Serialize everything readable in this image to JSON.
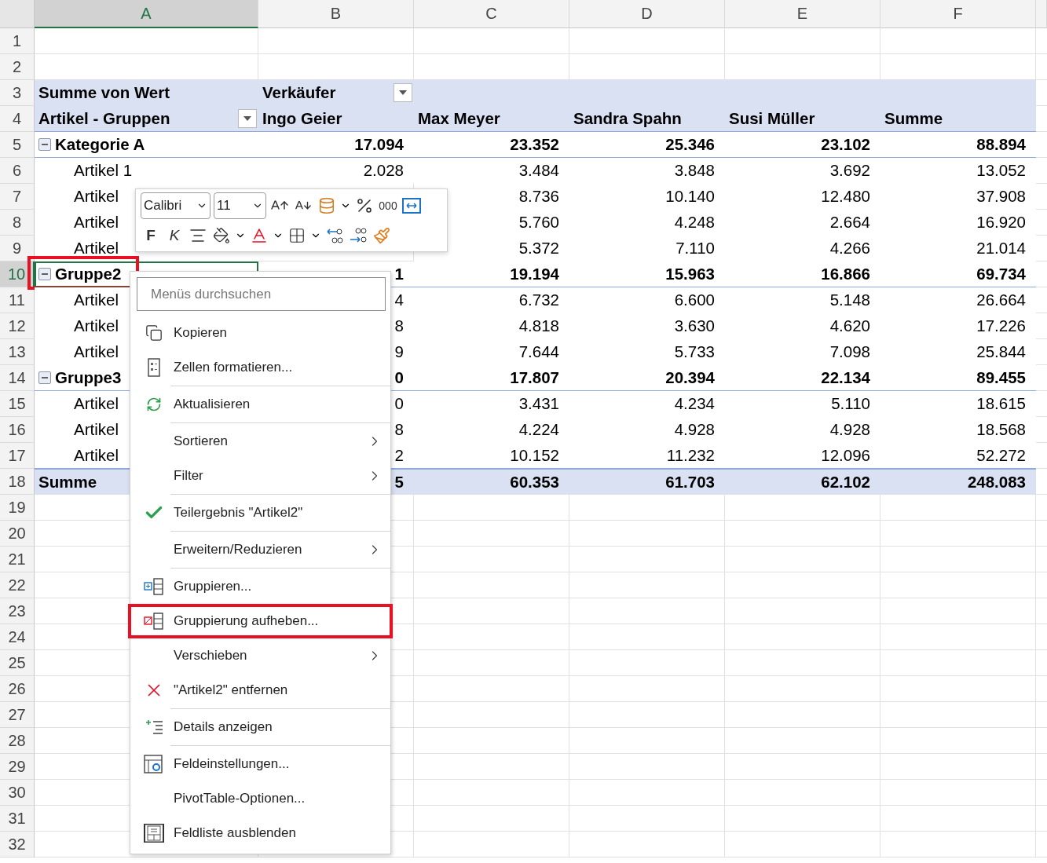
{
  "columns": [
    {
      "label": "A",
      "selected": true
    },
    {
      "label": "B",
      "selected": false
    },
    {
      "label": "C",
      "selected": false
    },
    {
      "label": "D",
      "selected": false
    },
    {
      "label": "E",
      "selected": false
    },
    {
      "label": "F",
      "selected": false
    }
  ],
  "rows": [
    {
      "number": "1",
      "kind": "blank",
      "selected": false,
      "cells": [
        null,
        null,
        null,
        null,
        null,
        null
      ]
    },
    {
      "number": "2",
      "kind": "blank",
      "selected": false,
      "cells": [
        null,
        null,
        null,
        null,
        null,
        null
      ]
    },
    {
      "number": "3",
      "kind": "header",
      "selected": false,
      "cells": [
        {
          "text": "Summe von Wert"
        },
        {
          "text": "Verkäufer",
          "dropdown": true
        },
        null,
        null,
        null,
        null
      ]
    },
    {
      "number": "4",
      "kind": "header-last",
      "selected": false,
      "cells": [
        {
          "text": "Artikel - Gruppen",
          "dropdown": true
        },
        {
          "text": "Ingo Geier"
        },
        {
          "text": "Max Meyer"
        },
        {
          "text": "Sandra Spahn"
        },
        {
          "text": "Susi Müller"
        },
        {
          "text": "Summe"
        }
      ]
    },
    {
      "number": "5",
      "kind": "group",
      "expanded": true,
      "selected": false,
      "cells": [
        {
          "text": "Kategorie A"
        },
        {
          "text": "17.094"
        },
        {
          "text": "23.352"
        },
        {
          "text": "25.346"
        },
        {
          "text": "23.102"
        },
        {
          "text": "88.894"
        }
      ]
    },
    {
      "number": "6",
      "kind": "item",
      "selected": false,
      "cells": [
        {
          "text": "Artikel 1"
        },
        {
          "text": "2.028"
        },
        {
          "text": "3.484"
        },
        {
          "text": "3.848"
        },
        {
          "text": "3.692"
        },
        {
          "text": "13.052"
        }
      ]
    },
    {
      "number": "7",
      "kind": "item",
      "selected": false,
      "cells": [
        {
          "text": "Artikel"
        },
        null,
        {
          "text": "8.736"
        },
        {
          "text": "10.140"
        },
        {
          "text": "12.480"
        },
        {
          "text": "37.908"
        }
      ]
    },
    {
      "number": "8",
      "kind": "item",
      "selected": false,
      "cells": [
        {
          "text": "Artikel"
        },
        null,
        {
          "text": "5.760"
        },
        {
          "text": "4.248"
        },
        {
          "text": "2.664"
        },
        {
          "text": "16.920"
        }
      ]
    },
    {
      "number": "9",
      "kind": "item",
      "selected": false,
      "cells": [
        {
          "text": "Artikel"
        },
        null,
        {
          "text": "5.372"
        },
        {
          "text": "7.110"
        },
        {
          "text": "4.266"
        },
        {
          "text": "21.014"
        }
      ]
    },
    {
      "number": "10",
      "kind": "group",
      "expanded": true,
      "selected": true,
      "highlighted": true,
      "cells": [
        {
          "text": "Gruppe2"
        },
        {
          "text": "1"
        },
        {
          "text": "19.194"
        },
        {
          "text": "15.963"
        },
        {
          "text": "16.866"
        },
        {
          "text": "69.734"
        }
      ]
    },
    {
      "number": "11",
      "kind": "item",
      "selected": false,
      "cells": [
        {
          "text": "Artikel"
        },
        {
          "text": "4"
        },
        {
          "text": "6.732"
        },
        {
          "text": "6.600"
        },
        {
          "text": "5.148"
        },
        {
          "text": "26.664"
        }
      ]
    },
    {
      "number": "12",
      "kind": "item",
      "selected": false,
      "cells": [
        {
          "text": "Artikel"
        },
        {
          "text": "8"
        },
        {
          "text": "4.818"
        },
        {
          "text": "3.630"
        },
        {
          "text": "4.620"
        },
        {
          "text": "17.226"
        }
      ]
    },
    {
      "number": "13",
      "kind": "item",
      "selected": false,
      "cells": [
        {
          "text": "Artikel"
        },
        {
          "text": "9"
        },
        {
          "text": "7.644"
        },
        {
          "text": "5.733"
        },
        {
          "text": "7.098"
        },
        {
          "text": "25.844"
        }
      ]
    },
    {
      "number": "14",
      "kind": "group",
      "expanded": true,
      "selected": false,
      "cells": [
        {
          "text": "Gruppe3"
        },
        {
          "text": "0"
        },
        {
          "text": "17.807"
        },
        {
          "text": "20.394"
        },
        {
          "text": "22.134"
        },
        {
          "text": "89.455"
        }
      ]
    },
    {
      "number": "15",
      "kind": "item",
      "selected": false,
      "cells": [
        {
          "text": "Artikel"
        },
        {
          "text": "0"
        },
        {
          "text": "3.431"
        },
        {
          "text": "4.234"
        },
        {
          "text": "5.110"
        },
        {
          "text": "18.615"
        }
      ]
    },
    {
      "number": "16",
      "kind": "item",
      "selected": false,
      "cells": [
        {
          "text": "Artikel"
        },
        {
          "text": "8"
        },
        {
          "text": "4.224"
        },
        {
          "text": "4.928"
        },
        {
          "text": "4.928"
        },
        {
          "text": "18.568"
        }
      ]
    },
    {
      "number": "17",
      "kind": "item-last",
      "selected": false,
      "cells": [
        {
          "text": "Artikel"
        },
        {
          "text": "2"
        },
        {
          "text": "10.152"
        },
        {
          "text": "11.232"
        },
        {
          "text": "12.096"
        },
        {
          "text": "52.272"
        }
      ]
    },
    {
      "number": "18",
      "kind": "total",
      "selected": false,
      "cells": [
        {
          "text": "Summe"
        },
        {
          "text": "5"
        },
        {
          "text": "60.353"
        },
        {
          "text": "61.703"
        },
        {
          "text": "62.102"
        },
        {
          "text": "248.083"
        }
      ]
    },
    {
      "number": "19",
      "kind": "blank",
      "selected": false,
      "cells": [
        null,
        null,
        null,
        null,
        null,
        null
      ]
    },
    {
      "number": "20",
      "kind": "blank",
      "selected": false,
      "cells": [
        null,
        null,
        null,
        null,
        null,
        null
      ]
    },
    {
      "number": "21",
      "kind": "blank",
      "selected": false,
      "cells": [
        null,
        null,
        null,
        null,
        null,
        null
      ]
    },
    {
      "number": "22",
      "kind": "blank",
      "selected": false,
      "cells": [
        null,
        null,
        null,
        null,
        null,
        null
      ]
    },
    {
      "number": "23",
      "kind": "blank",
      "selected": false,
      "cells": [
        null,
        null,
        null,
        null,
        null,
        null
      ]
    },
    {
      "number": "24",
      "kind": "blank",
      "selected": false,
      "cells": [
        null,
        null,
        null,
        null,
        null,
        null
      ]
    },
    {
      "number": "25",
      "kind": "blank",
      "selected": false,
      "cells": [
        null,
        null,
        null,
        null,
        null,
        null
      ]
    },
    {
      "number": "26",
      "kind": "blank",
      "selected": false,
      "cells": [
        null,
        null,
        null,
        null,
        null,
        null
      ]
    },
    {
      "number": "27",
      "kind": "blank",
      "selected": false,
      "cells": [
        null,
        null,
        null,
        null,
        null,
        null
      ]
    },
    {
      "number": "28",
      "kind": "blank",
      "selected": false,
      "cells": [
        null,
        null,
        null,
        null,
        null,
        null
      ]
    },
    {
      "number": "29",
      "kind": "blank",
      "selected": false,
      "cells": [
        null,
        null,
        null,
        null,
        null,
        null
      ]
    },
    {
      "number": "30",
      "kind": "blank",
      "selected": false,
      "cells": [
        null,
        null,
        null,
        null,
        null,
        null
      ]
    },
    {
      "number": "31",
      "kind": "blank",
      "selected": false,
      "cells": [
        null,
        null,
        null,
        null,
        null,
        null
      ]
    },
    {
      "number": "32",
      "kind": "blank",
      "selected": false,
      "cells": [
        null,
        null,
        null,
        null,
        null,
        null
      ]
    }
  ],
  "mini_toolbar": {
    "font": "Calibri",
    "size": "11",
    "row_1": [
      {
        "kind": "grow-font"
      },
      {
        "kind": "shrink-font"
      },
      {
        "kind": "number-format"
      },
      {
        "kind": "percent"
      },
      {
        "kind": "text",
        "label": "000"
      },
      {
        "kind": "wrap"
      }
    ],
    "row_2": [
      {
        "kind": "bold",
        "label": "F"
      },
      {
        "kind": "italic",
        "label": "K"
      },
      {
        "kind": "align"
      },
      {
        "kind": "fill"
      },
      {
        "kind": "font-color"
      },
      {
        "kind": "borders"
      },
      {
        "kind": "decimals-less"
      },
      {
        "kind": "decimals-more"
      },
      {
        "kind": "painter"
      }
    ]
  },
  "context_menu": {
    "search": {
      "placeholder": "Menüs durchsuchen"
    },
    "items": [
      {
        "label": "Kopieren",
        "kind": "copy",
        "submenu": false,
        "separator_after": false,
        "highlighted": false
      },
      {
        "label": "Zellen formatieren...",
        "kind": "format",
        "submenu": false,
        "separator_after": true,
        "highlighted": false
      },
      {
        "label": "Aktualisieren",
        "kind": "refresh",
        "submenu": false,
        "separator_after": true,
        "highlighted": false
      },
      {
        "label": "Sortieren",
        "kind": "plain",
        "submenu": true,
        "separator_after": false,
        "highlighted": false
      },
      {
        "label": "Filter",
        "kind": "plain",
        "submenu": true,
        "separator_after": true,
        "highlighted": false
      },
      {
        "label": "Teilergebnis \"Artikel2\"",
        "kind": "check",
        "submenu": false,
        "separator_after": true,
        "highlighted": false
      },
      {
        "label": "Erweitern/Reduzieren",
        "kind": "plain",
        "submenu": true,
        "separator_after": true,
        "highlighted": false
      },
      {
        "label": "Gruppieren...",
        "kind": "group",
        "submenu": false,
        "separator_after": false,
        "highlighted": false
      },
      {
        "label": "Gruppierung aufheben...",
        "kind": "ungroup",
        "submenu": false,
        "separator_after": false,
        "highlighted": true
      },
      {
        "label": "Verschieben",
        "kind": "plain",
        "submenu": true,
        "separator_after": false,
        "highlighted": false
      },
      {
        "label": "\"Artikel2\" entfernen",
        "kind": "remove",
        "submenu": false,
        "separator_after": true,
        "highlighted": false
      },
      {
        "label": "Details anzeigen",
        "kind": "details",
        "submenu": false,
        "separator_after": true,
        "highlighted": false
      },
      {
        "label": "Feldeinstellungen...",
        "kind": "field-settings",
        "submenu": false,
        "separator_after": false,
        "highlighted": false
      },
      {
        "label": "PivotTable-Optionen...",
        "kind": "plain",
        "submenu": false,
        "separator_after": false,
        "highlighted": false
      },
      {
        "label": "Feldliste ausblenden",
        "kind": "field-list",
        "submenu": false,
        "separator_after": false,
        "highlighted": false
      }
    ]
  }
}
